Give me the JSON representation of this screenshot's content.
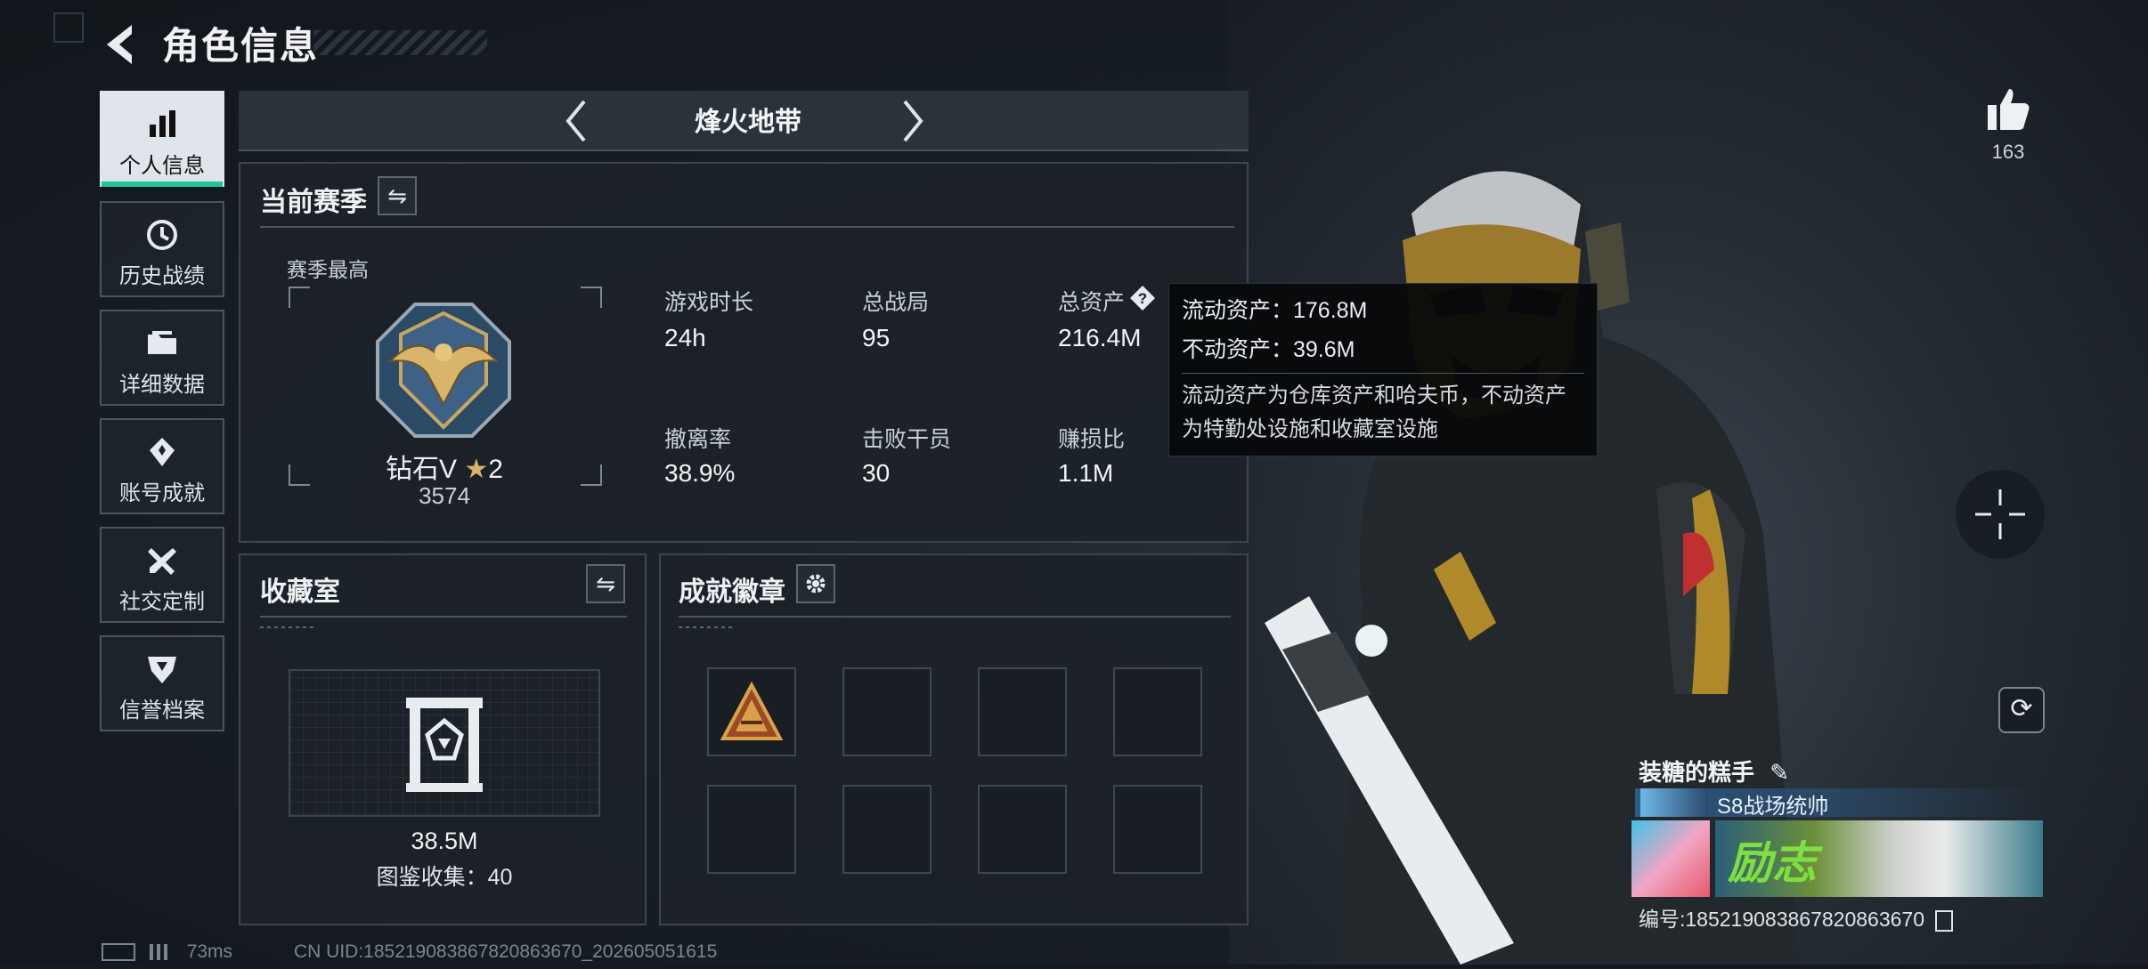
{
  "header": {
    "title": "角色信息"
  },
  "sidebar": {
    "items": [
      {
        "label": "个人信息",
        "icon": "bar-chart-icon",
        "active": true
      },
      {
        "label": "历史战绩",
        "icon": "history-clock-icon"
      },
      {
        "label": "详细数据",
        "icon": "folder-icon"
      },
      {
        "label": "账号成就",
        "icon": "achievement-medal-icon"
      },
      {
        "label": "社交定制",
        "icon": "tools-icon"
      },
      {
        "label": "信誉档案",
        "icon": "shield-badge-icon"
      }
    ]
  },
  "mode_tab": {
    "title": "烽火地带"
  },
  "season": {
    "title": "当前赛季",
    "best_label": "赛季最高",
    "rank_name": "钻石V",
    "rank_stars": "2",
    "rank_score": "3574",
    "stats": [
      {
        "label": "游戏时长",
        "value": "24h"
      },
      {
        "label": "总战局",
        "value": "95"
      },
      {
        "label": "总资产",
        "value": "216.4M"
      },
      {
        "label": "撤离率",
        "value": "38.9%"
      },
      {
        "label": "击败干员",
        "value": "30"
      },
      {
        "label": "赚损比",
        "value": "1.1M"
      }
    ]
  },
  "tooltip": {
    "liquid": "流动资产：176.8M",
    "fixed": "不动资产：39.6M",
    "desc1": "流动资产为仓库资产和哈夫币，不动资产",
    "desc2": "为特勤处设施和收藏室设施"
  },
  "collection": {
    "title": "收藏室",
    "value": "38.5M",
    "count": "图鉴收集：40"
  },
  "badges": {
    "title": "成就徽章"
  },
  "player": {
    "likes": "163",
    "name": "装糖的糕手",
    "title": "S8战场统帅",
    "banner_text": "励志",
    "id": "编号:1852190838678208636​70"
  },
  "footer": {
    "ping": "73ms",
    "uid": "CN UID:18521908386782086367​0_202605051615"
  },
  "colors": {
    "accent": "#1fc59a",
    "panel": "#1c2228"
  }
}
